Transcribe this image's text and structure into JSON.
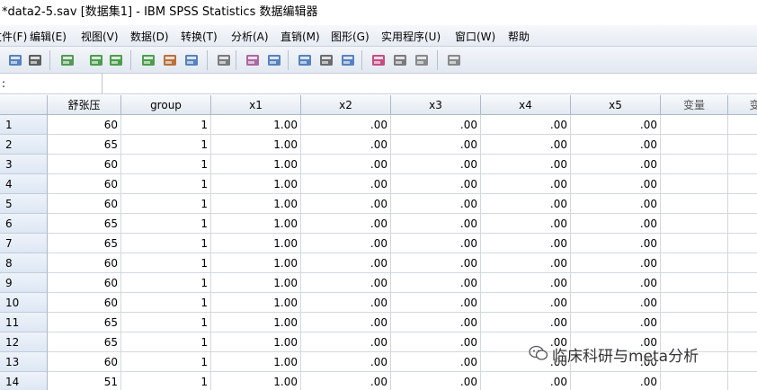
{
  "window": {
    "title": "*data2-5.sav [数据集1] - IBM SPSS Statistics 数据编辑器"
  },
  "menu": [
    "文件(F)",
    "编辑(E)",
    "视图(V)",
    "数据(D)",
    "转换(T)",
    "分析(A)",
    "直销(M)",
    "图形(G)",
    "实用程序(U)",
    "窗口(W)",
    "帮助"
  ],
  "toolbar": {
    "icons": [
      "save-icon",
      "print-icon",
      "dialog-recall-icon",
      "undo-icon",
      "redo-icon",
      "goto-case-icon",
      "goto-variable-icon",
      "variables-icon",
      "find-icon",
      "insert-cases-icon",
      "insert-variable-icon",
      "split-file-icon",
      "weight-cases-icon",
      "select-cases-icon",
      "value-labels-icon",
      "use-sets-icon",
      "show-all-variables-icon",
      "spelling-icon"
    ]
  },
  "cellbar": {
    "ref": ":",
    "value": ""
  },
  "table": {
    "columns": [
      "舒张压",
      "group",
      "x1",
      "x2",
      "x3",
      "x4",
      "x5",
      "变量",
      "变"
    ],
    "rows": [
      {
        "id": "1",
        "v": [
          "60",
          "1",
          "1.00",
          ".00",
          ".00",
          ".00",
          ".00",
          "",
          ""
        ]
      },
      {
        "id": "2",
        "v": [
          "65",
          "1",
          "1.00",
          ".00",
          ".00",
          ".00",
          ".00",
          "",
          ""
        ]
      },
      {
        "id": "3",
        "v": [
          "60",
          "1",
          "1.00",
          ".00",
          ".00",
          ".00",
          ".00",
          "",
          ""
        ]
      },
      {
        "id": "4",
        "v": [
          "60",
          "1",
          "1.00",
          ".00",
          ".00",
          ".00",
          ".00",
          "",
          ""
        ]
      },
      {
        "id": "5",
        "v": [
          "60",
          "1",
          "1.00",
          ".00",
          ".00",
          ".00",
          ".00",
          "",
          ""
        ]
      },
      {
        "id": "6",
        "v": [
          "65",
          "1",
          "1.00",
          ".00",
          ".00",
          ".00",
          ".00",
          "",
          ""
        ]
      },
      {
        "id": "7",
        "v": [
          "65",
          "1",
          "1.00",
          ".00",
          ".00",
          ".00",
          ".00",
          "",
          ""
        ]
      },
      {
        "id": "8",
        "v": [
          "60",
          "1",
          "1.00",
          ".00",
          ".00",
          ".00",
          ".00",
          "",
          ""
        ]
      },
      {
        "id": "9",
        "v": [
          "60",
          "1",
          "1.00",
          ".00",
          ".00",
          ".00",
          ".00",
          "",
          ""
        ]
      },
      {
        "id": "10",
        "v": [
          "60",
          "1",
          "1.00",
          ".00",
          ".00",
          ".00",
          ".00",
          "",
          ""
        ]
      },
      {
        "id": "11",
        "v": [
          "65",
          "1",
          "1.00",
          ".00",
          ".00",
          ".00",
          ".00",
          "",
          ""
        ]
      },
      {
        "id": "12",
        "v": [
          "65",
          "1",
          "1.00",
          ".00",
          ".00",
          ".00",
          ".00",
          "",
          ""
        ]
      },
      {
        "id": "13",
        "v": [
          "60",
          "1",
          "1.00",
          ".00",
          ".00",
          ".00",
          ".00",
          "",
          ""
        ]
      },
      {
        "id": "14",
        "v": [
          "51",
          "1",
          "1.00",
          ".00",
          ".00",
          ".00",
          ".00",
          "",
          ""
        ]
      }
    ]
  },
  "watermark": {
    "text": "临床科研与meta分析"
  },
  "colors": {
    "header_bg": "#e3e9f1",
    "rowhdr_bg": "#dde7f4",
    "grid_line": "#d3d8e0",
    "accent": "#2f5fa7"
  }
}
